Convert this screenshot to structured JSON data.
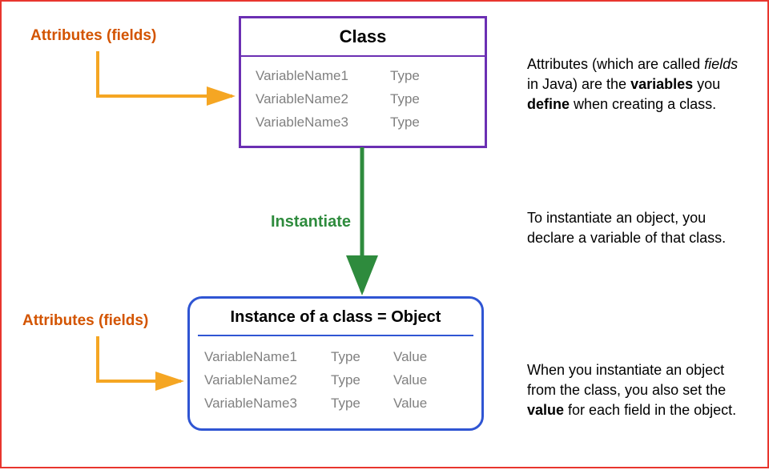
{
  "labels": {
    "attributes": "Attributes (fields)",
    "instantiate": "Instantiate"
  },
  "classBox": {
    "title": "Class",
    "rows": [
      {
        "name": "VariableName1",
        "type": "Type"
      },
      {
        "name": "VariableName2",
        "type": "Type"
      },
      {
        "name": "VariableName3",
        "type": "Type"
      }
    ]
  },
  "objectBox": {
    "title": "Instance of a class = Object",
    "rows": [
      {
        "name": "VariableName1",
        "type": "Type",
        "value": "Value"
      },
      {
        "name": "VariableName2",
        "type": "Type",
        "value": "Value"
      },
      {
        "name": "VariableName3",
        "type": "Type",
        "value": "Value"
      }
    ]
  },
  "explain": {
    "p1a": "Attributes (which are called ",
    "p1b": "fields",
    "p1c": " in Java) are the ",
    "p1d": "variables",
    "p1e": " you ",
    "p1f": "define",
    "p1g": " when creating a class.",
    "p2": "To instantiate an object, you declare a variable of that class.",
    "p3a": "When you instantiate an object from the class, you also set the ",
    "p3b": "value",
    "p3c": " for each field in the object."
  }
}
